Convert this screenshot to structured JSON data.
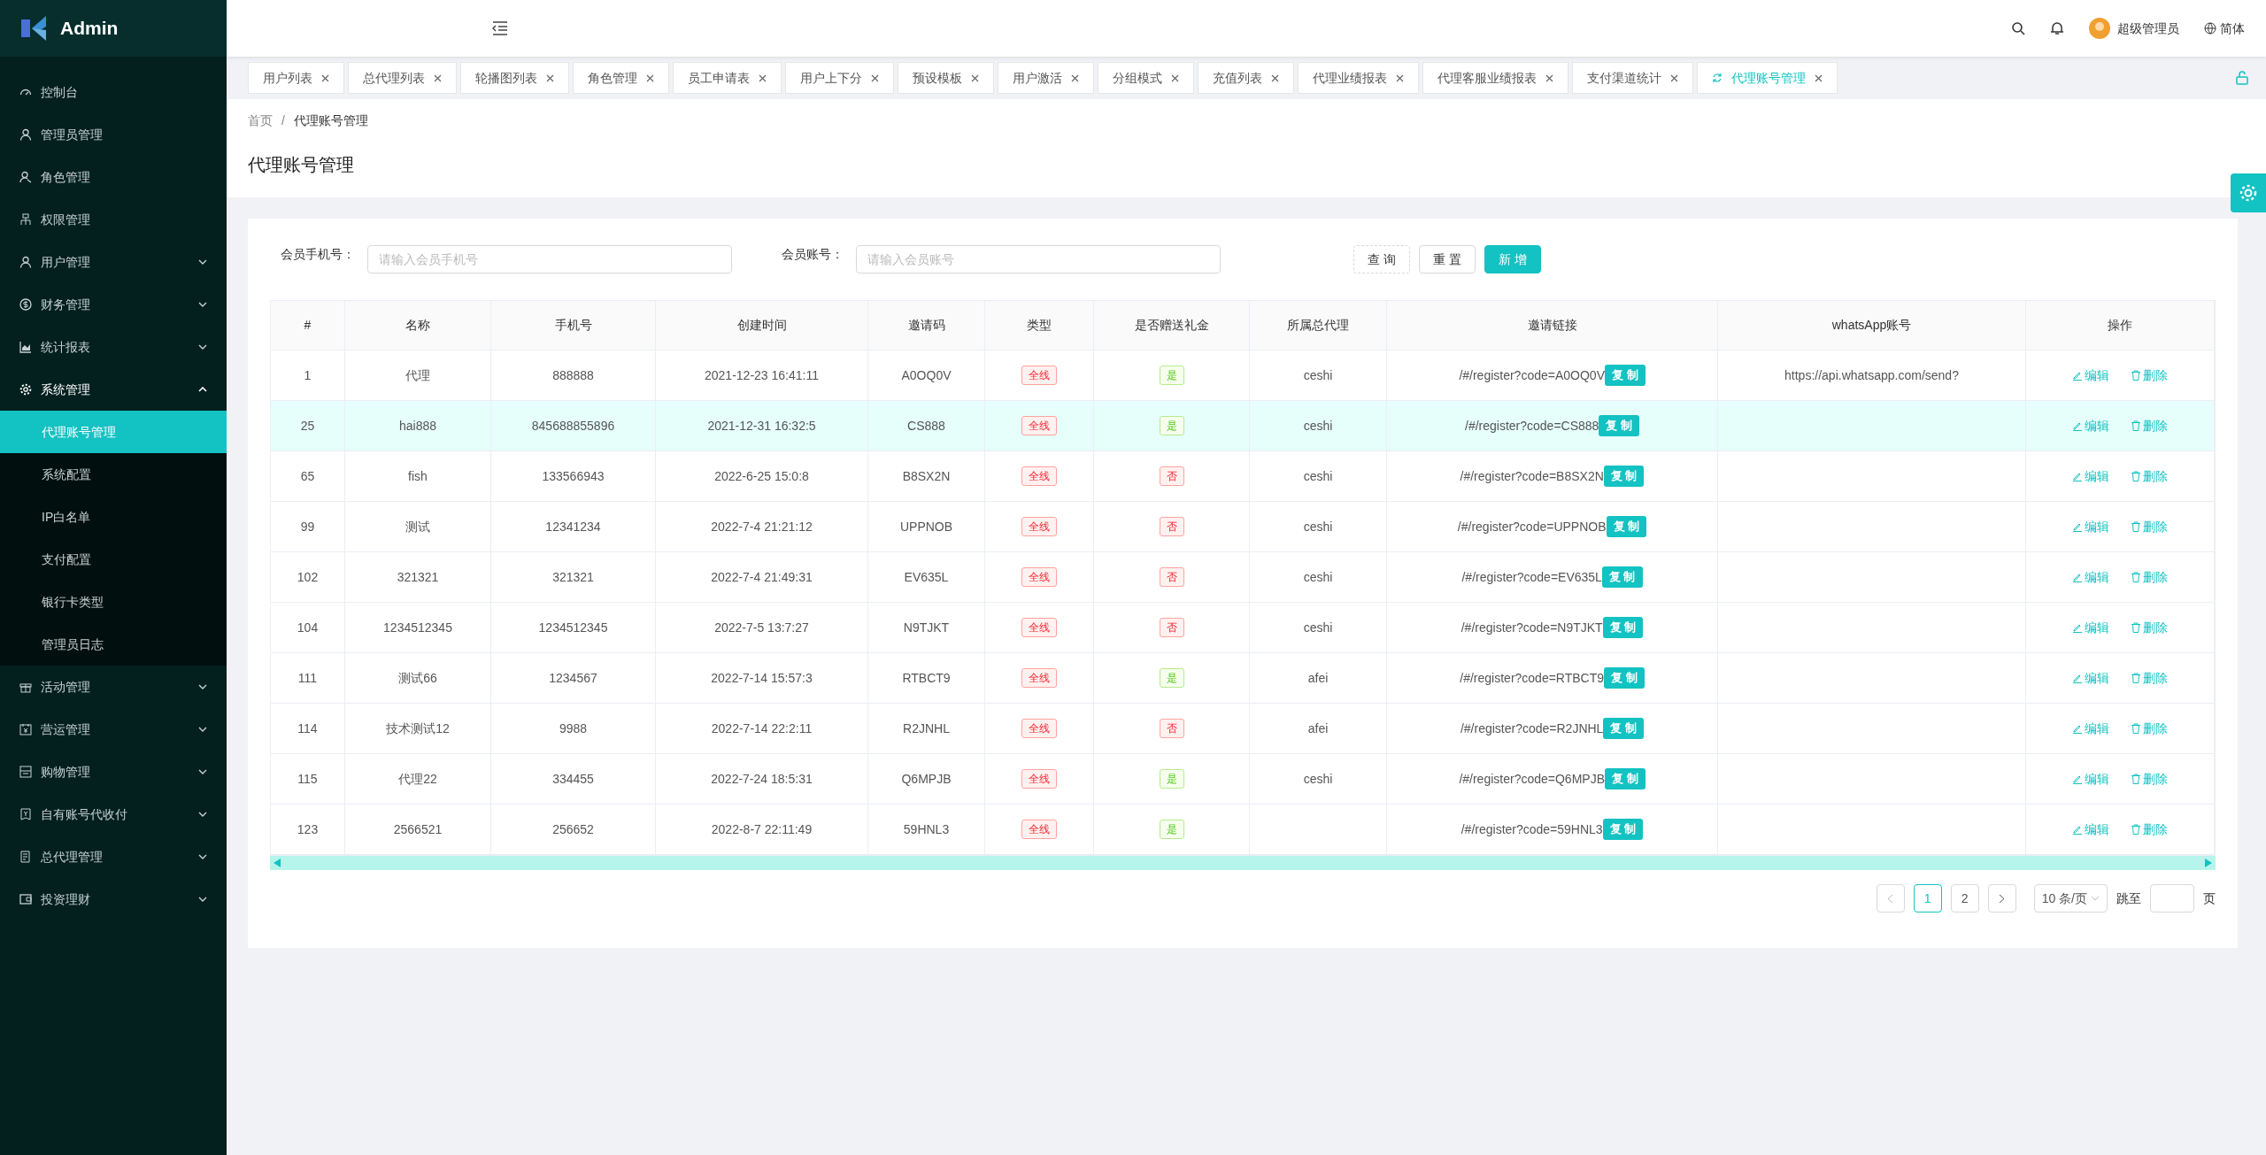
{
  "brand": "Admin",
  "sidebar": {
    "items": [
      {
        "label": "控制台",
        "kind": "link"
      },
      {
        "label": "管理员管理",
        "kind": "link"
      },
      {
        "label": "角色管理",
        "kind": "link"
      },
      {
        "label": "权限管理",
        "kind": "link"
      },
      {
        "label": "用户管理",
        "kind": "group",
        "expanded": false
      },
      {
        "label": "财务管理",
        "kind": "group",
        "expanded": false
      },
      {
        "label": "统计报表",
        "kind": "group",
        "expanded": false
      },
      {
        "label": "系统管理",
        "kind": "group",
        "expanded": true,
        "children": [
          {
            "label": "代理账号管理",
            "selected": true
          },
          {
            "label": "系统配置",
            "selected": false
          },
          {
            "label": "IP白名单",
            "selected": false
          },
          {
            "label": "支付配置",
            "selected": false
          },
          {
            "label": "银行卡类型",
            "selected": false
          },
          {
            "label": "管理员日志",
            "selected": false
          }
        ]
      },
      {
        "label": "活动管理",
        "kind": "group",
        "expanded": false
      },
      {
        "label": "营运管理",
        "kind": "group",
        "expanded": false
      },
      {
        "label": "购物管理",
        "kind": "group",
        "expanded": false
      },
      {
        "label": "自有账号代收付",
        "kind": "group",
        "expanded": false
      },
      {
        "label": "总代理管理",
        "kind": "group",
        "expanded": false
      },
      {
        "label": "投资理财",
        "kind": "group",
        "expanded": false
      }
    ]
  },
  "header": {
    "user": "超级管理员",
    "language": "简体"
  },
  "tabs": [
    {
      "label": "用户列表",
      "selected": false
    },
    {
      "label": "总代理列表",
      "selected": false
    },
    {
      "label": "轮播图列表",
      "selected": false
    },
    {
      "label": "角色管理",
      "selected": false
    },
    {
      "label": "员工申请表",
      "selected": false
    },
    {
      "label": "用户上下分",
      "selected": false
    },
    {
      "label": "预设模板",
      "selected": false
    },
    {
      "label": "用户激活",
      "selected": false
    },
    {
      "label": "分组模式",
      "selected": false
    },
    {
      "label": "充值列表",
      "selected": false
    },
    {
      "label": "代理业绩报表",
      "selected": false
    },
    {
      "label": "代理客服业绩报表",
      "selected": false
    },
    {
      "label": "支付渠道统计",
      "selected": false
    },
    {
      "label": "代理账号管理",
      "selected": true
    }
  ],
  "breadcrumb": [
    "首页",
    "代理账号管理"
  ],
  "breadcrumb_separator": "/",
  "page_title": "代理账号管理",
  "filters": [
    {
      "label": "会员手机号：",
      "placeholder": "请输入会员手机号"
    },
    {
      "label": "会员账号：",
      "placeholder": "请输入会员账号"
    }
  ],
  "buttons": [
    {
      "label": "查 询",
      "kind": "dashed"
    },
    {
      "label": "重 置",
      "kind": "default"
    },
    {
      "label": "新 增",
      "kind": "primary"
    }
  ],
  "table": {
    "columns": [
      "#",
      "名称",
      "手机号",
      "创建时间",
      "邀请码",
      "类型",
      "是否赠送礼金",
      "所属总代理",
      "邀请链接",
      "whatsApp账号",
      "操作"
    ],
    "rows": [
      {
        "id": "1",
        "name": "代理",
        "phone": "888888",
        "created": "2021-12-23 16:41:11",
        "code": "A0OQ0V",
        "type": "全线",
        "gift": "是",
        "gift_on": true,
        "agent": "ceshi",
        "link": "/#/register?code=A0OQ0V",
        "copy": "复 制",
        "whatsapp": "https://api.whatsapp.com/send?",
        "edit": "编辑",
        "delete": "删除",
        "selected": false
      },
      {
        "id": "25",
        "name": "hai888",
        "phone": "845688855896",
        "created": "2021-12-31 16:32:5",
        "code": "CS888",
        "type": "全线",
        "gift": "是",
        "gift_on": true,
        "agent": "ceshi",
        "link": "/#/register?code=CS888",
        "copy": "复 制",
        "edit": "编辑",
        "delete": "删除",
        "selected": true
      },
      {
        "id": "65",
        "name": "fish",
        "phone": "133566943",
        "created": "2022-6-25 15:0:8",
        "code": "B8SX2N",
        "type": "全线",
        "gift": "否",
        "gift_on": false,
        "agent": "ceshi",
        "link": "/#/register?code=B8SX2N",
        "copy": "复 制",
        "edit": "编辑",
        "delete": "删除",
        "selected": false
      },
      {
        "id": "99",
        "name": "测试",
        "phone": "12341234",
        "created": "2022-7-4 21:21:12",
        "code": "UPPNOB",
        "type": "全线",
        "gift": "否",
        "gift_on": false,
        "agent": "ceshi",
        "link": "/#/register?code=UPPNOB",
        "copy": "复 制",
        "edit": "编辑",
        "delete": "删除",
        "selected": false
      },
      {
        "id": "102",
        "name": "321321",
        "phone": "321321",
        "created": "2022-7-4 21:49:31",
        "code": "EV635L",
        "type": "全线",
        "gift": "否",
        "gift_on": false,
        "agent": "ceshi",
        "link": "/#/register?code=EV635L",
        "copy": "复 制",
        "edit": "编辑",
        "delete": "删除",
        "selected": false
      },
      {
        "id": "104",
        "name": "1234512345",
        "phone": "1234512345",
        "created": "2022-7-5 13:7:27",
        "code": "N9TJKT",
        "type": "全线",
        "gift": "否",
        "gift_on": false,
        "agent": "ceshi",
        "link": "/#/register?code=N9TJKT",
        "copy": "复 制",
        "edit": "编辑",
        "delete": "删除",
        "selected": false
      },
      {
        "id": "111",
        "name": "测试66",
        "phone": "1234567",
        "created": "2022-7-14 15:57:3",
        "code": "RTBCT9",
        "type": "全线",
        "gift": "是",
        "gift_on": true,
        "agent": "afei",
        "link": "/#/register?code=RTBCT9",
        "copy": "复 制",
        "edit": "编辑",
        "delete": "删除",
        "selected": false
      },
      {
        "id": "114",
        "name": "技术测试12",
        "phone": "9988",
        "created": "2022-7-14 22:2:11",
        "code": "R2JNHL",
        "type": "全线",
        "gift": "否",
        "gift_on": false,
        "agent": "afei",
        "link": "/#/register?code=R2JNHL",
        "copy": "复 制",
        "edit": "编辑",
        "delete": "删除",
        "selected": false
      },
      {
        "id": "115",
        "name": "代理22",
        "phone": "334455",
        "created": "2022-7-24 18:5:31",
        "code": "Q6MPJB",
        "type": "全线",
        "gift": "是",
        "gift_on": true,
        "agent": "ceshi",
        "link": "/#/register?code=Q6MPJB",
        "copy": "复 制",
        "edit": "编辑",
        "delete": "删除",
        "selected": false
      },
      {
        "id": "123",
        "name": "2566521",
        "phone": "256652",
        "created": "2022-8-7 22:11:49",
        "code": "59HNL3",
        "type": "全线",
        "gift": "是",
        "gift_on": true,
        "link": "/#/register?code=59HNL3",
        "copy": "复 制",
        "edit": "编辑",
        "delete": "删除",
        "selected": false
      }
    ]
  },
  "pagination": {
    "pages": [
      {
        "label": "1",
        "selected": true
      },
      {
        "label": "2",
        "selected": false
      }
    ],
    "page_size": "10 条/页",
    "jump_label": "跳至",
    "unit": "页"
  }
}
